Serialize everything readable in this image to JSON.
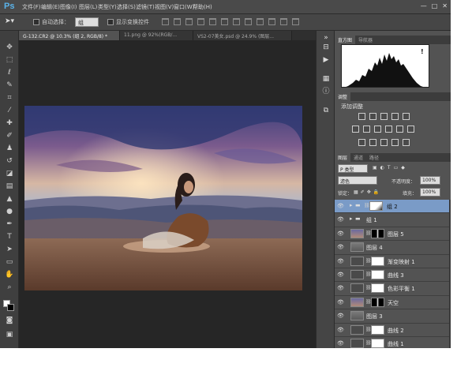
{
  "app": {
    "logo": "Ps"
  },
  "menu": [
    "文件(F)",
    "编辑(E)",
    "图像(I)",
    "图层(L)",
    "类型(Y)",
    "选择(S)",
    "滤镜(T)",
    "视图(V)",
    "窗口(W)",
    "帮助(H)"
  ],
  "window_controls": {
    "minimize": "—",
    "restore": "□",
    "close": "✕"
  },
  "options": {
    "auto_select_label": "自动选择：",
    "auto_select_value": "组",
    "transform_label": "显示变换控件"
  },
  "doc_tabs": [
    "G-132.CR2 @ 10.3% (组 2, RGB/8) *",
    "11.png @ 92%(RGB/...",
    "VS2-07美女.psd @ 24.9% (图层..."
  ],
  "histogram_panel": {
    "tabs": [
      "直方图",
      "导航器"
    ],
    "warning": "!"
  },
  "adjustments_panel": {
    "tab": "调整",
    "title": "添加调整"
  },
  "layers_panel": {
    "tabs": [
      "图层",
      "通道",
      "路径"
    ],
    "kind_label": "P 类型",
    "blend_mode": "滤色",
    "opacity_label": "不透明度：",
    "opacity_value": "100%",
    "lock_label": "锁定：",
    "fill_label": "填充：",
    "fill_value": "100%",
    "layers": [
      {
        "name": "组 2",
        "kind": "group",
        "selected": true
      },
      {
        "name": "组 1",
        "kind": "group",
        "selected": false
      },
      {
        "name": "图层 5",
        "kind": "image_mask",
        "selected": false
      },
      {
        "name": "图层 4",
        "kind": "image",
        "selected": false
      },
      {
        "name": "渐变映射 1",
        "kind": "adjust",
        "selected": false
      },
      {
        "name": "曲线 3",
        "kind": "adjust",
        "selected": false
      },
      {
        "name": "色彩平衡 1",
        "kind": "adjust",
        "selected": false
      },
      {
        "name": "天空",
        "kind": "image_mask",
        "selected": false
      },
      {
        "name": "图层 3",
        "kind": "image",
        "selected": false
      },
      {
        "name": "曲线 2",
        "kind": "adjust",
        "selected": false
      },
      {
        "name": "曲线 1",
        "kind": "adjust",
        "selected": false
      }
    ]
  }
}
